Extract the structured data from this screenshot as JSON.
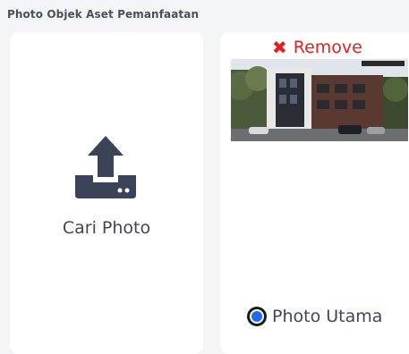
{
  "section": {
    "title": "Photo Objek Aset Pemanfaatan"
  },
  "upload": {
    "label": "Cari Photo",
    "icon": "upload-icon"
  },
  "photo_card": {
    "remove_label": "Remove",
    "remove_icon": "close-icon",
    "image_alt": "building-photo",
    "primary_label": "Photo Utama",
    "primary_selected": true
  },
  "colors": {
    "background": "#f4f5f7",
    "card": "#ffffff",
    "icon": "#3a4358",
    "remove": "#e51f1f",
    "radio": "#1e6bf0"
  }
}
